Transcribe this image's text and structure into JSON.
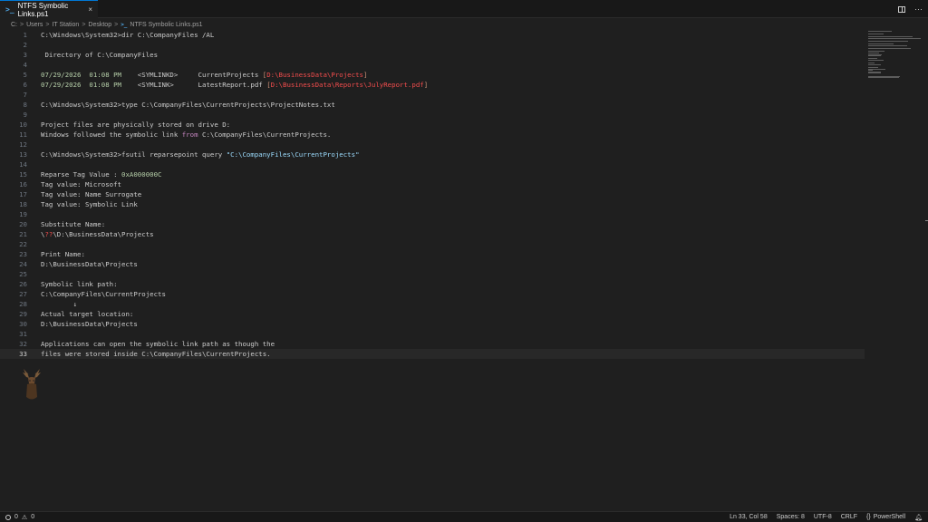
{
  "tab": {
    "label": "NTFS Symbolic Links.ps1",
    "close": "×"
  },
  "tab_actions": {
    "more": "···"
  },
  "breadcrumb": [
    "C:",
    "Users",
    "IT Station",
    "Desktop",
    "NTFS Symbolic Links.ps1"
  ],
  "breadcrumb_sep": ">",
  "lines": [
    {
      "n": "1",
      "segs": [
        {
          "t": "C:\\Windows\\System32>dir C:\\CompanyFiles /AL"
        }
      ]
    },
    {
      "n": "2",
      "segs": []
    },
    {
      "n": "3",
      "segs": [
        {
          "t": " Directory of C:\\CompanyFiles"
        }
      ]
    },
    {
      "n": "4",
      "segs": []
    },
    {
      "n": "5",
      "segs": [
        {
          "t": "07/29/2026  01:08 PM",
          "c": "green"
        },
        {
          "t": "    <SYMLINKD>     CurrentProjects "
        },
        {
          "t": "[",
          "c": "orange"
        },
        {
          "t": "D:\\BusinessData\\Projects",
          "c": "red"
        },
        {
          "t": "]",
          "c": "orange"
        }
      ]
    },
    {
      "n": "6",
      "segs": [
        {
          "t": "07/29/2026  01:08 PM",
          "c": "green"
        },
        {
          "t": "    <SYMLINK>      LatestReport.pdf "
        },
        {
          "t": "[",
          "c": "orange"
        },
        {
          "t": "D:\\BusinessData\\Reports\\JulyReport.pdf",
          "c": "red"
        },
        {
          "t": "]",
          "c": "orange"
        }
      ]
    },
    {
      "n": "7",
      "segs": []
    },
    {
      "n": "8",
      "segs": [
        {
          "t": "C:\\Windows\\System32>type C:\\CompanyFiles\\CurrentProjects\\ProjectNotes.txt"
        }
      ]
    },
    {
      "n": "9",
      "segs": []
    },
    {
      "n": "10",
      "segs": [
        {
          "t": "Project files are physically stored on drive D:"
        }
      ]
    },
    {
      "n": "11",
      "segs": [
        {
          "t": "Windows followed the symbolic link "
        },
        {
          "t": "from",
          "c": "magenta"
        },
        {
          "t": " C:\\CompanyFiles\\CurrentProjects."
        }
      ]
    },
    {
      "n": "12",
      "segs": []
    },
    {
      "n": "13",
      "segs": [
        {
          "t": "C:\\Windows\\System32>fsutil reparsepoint query "
        },
        {
          "t": "\"C:\\CompanyFiles\\CurrentProjects\"",
          "c": "blue"
        }
      ]
    },
    {
      "n": "14",
      "segs": []
    },
    {
      "n": "15",
      "segs": [
        {
          "t": "Reparse Tag Value : "
        },
        {
          "t": "0xA000000C",
          "c": "green"
        }
      ]
    },
    {
      "n": "16",
      "segs": [
        {
          "t": "Tag value: Microsoft"
        }
      ]
    },
    {
      "n": "17",
      "segs": [
        {
          "t": "Tag value: Name Surrogate"
        }
      ]
    },
    {
      "n": "18",
      "segs": [
        {
          "t": "Tag value: Symbolic Link"
        }
      ]
    },
    {
      "n": "19",
      "segs": []
    },
    {
      "n": "20",
      "segs": [
        {
          "t": "Substitute Name:"
        }
      ]
    },
    {
      "n": "21",
      "segs": [
        {
          "t": "\\"
        },
        {
          "t": "??",
          "c": "red"
        },
        {
          "t": "\\D:\\BusinessData\\Projects"
        }
      ]
    },
    {
      "n": "22",
      "segs": []
    },
    {
      "n": "23",
      "segs": [
        {
          "t": "Print Name:"
        }
      ]
    },
    {
      "n": "24",
      "segs": [
        {
          "t": "D:\\BusinessData\\Projects"
        }
      ]
    },
    {
      "n": "25",
      "segs": []
    },
    {
      "n": "26",
      "segs": [
        {
          "t": "Symbolic link path:"
        }
      ]
    },
    {
      "n": "27",
      "segs": [
        {
          "t": "C:\\CompanyFiles\\CurrentProjects"
        }
      ]
    },
    {
      "n": "28",
      "segs": [
        {
          "t": "        ↓"
        }
      ]
    },
    {
      "n": "29",
      "segs": [
        {
          "t": "Actual target location:"
        }
      ]
    },
    {
      "n": "30",
      "segs": [
        {
          "t": "D:\\BusinessData\\Projects"
        }
      ]
    },
    {
      "n": "31",
      "segs": []
    },
    {
      "n": "32",
      "segs": [
        {
          "t": "Applications can open the symbolic link path as though the"
        }
      ]
    },
    {
      "n": "33",
      "segs": [
        {
          "t": "files were stored inside C:\\CompanyFiles\\CurrentProjects."
        }
      ],
      "current": true
    }
  ],
  "status": {
    "errors": "0",
    "warnings": "0",
    "position": "Ln 33, Col 58",
    "spaces": "Spaces: 8",
    "encoding": "UTF-8",
    "eol": "CRLF",
    "language": "PowerShell"
  },
  "colors": {
    "green": "#b5cea8",
    "orange": "#ce9178",
    "red": "#f14c4c",
    "magenta": "#c586c0",
    "blue": "#9cdcfe",
    "accent": "#0078d4"
  },
  "icons": {
    "tab": "powershell-icon",
    "split": "split-editor-icon",
    "errors": "error-icon",
    "warnings": "warning-icon",
    "notifications": "bell-icon"
  }
}
